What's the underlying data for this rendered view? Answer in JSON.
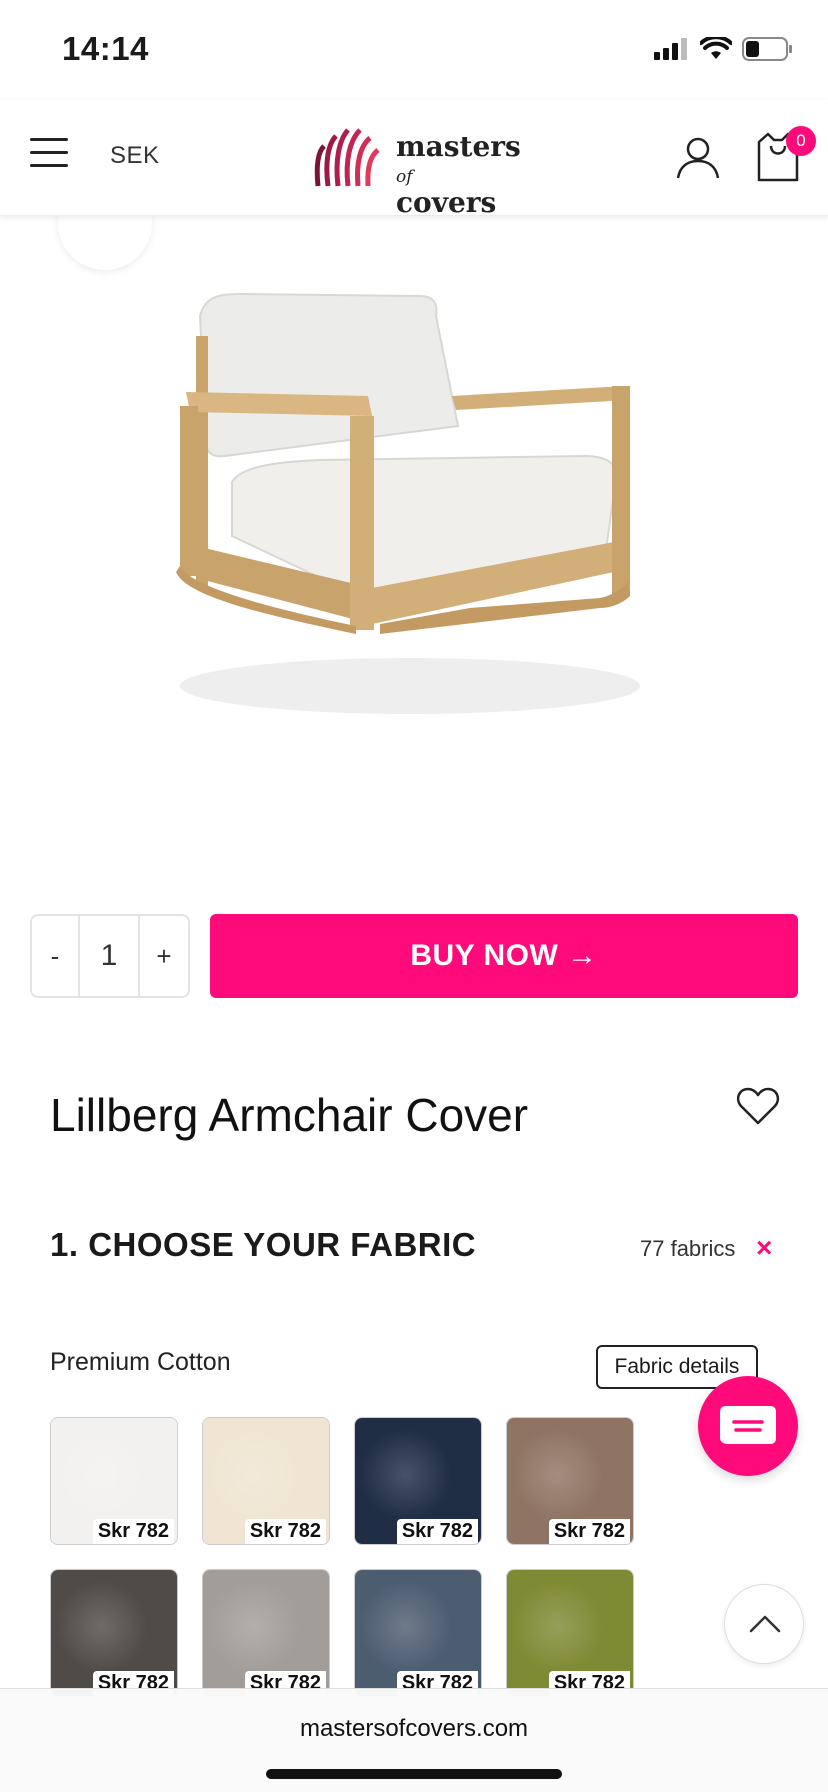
{
  "status_bar": {
    "time": "14:14"
  },
  "header": {
    "currency": "SEK",
    "logo_line1": "masters",
    "logo_of": "of",
    "logo_line2": "covers",
    "cart_count": "0",
    "brand_color": "#ff0a7a"
  },
  "purchase": {
    "qty_minus": "-",
    "qty_value": "1",
    "qty_plus": "+",
    "buy_label": "BUY NOW →"
  },
  "product": {
    "title": "Lillberg Armchair Cover"
  },
  "fabric_section": {
    "heading": "1. CHOOSE YOUR FABRIC",
    "count": "77 fabrics",
    "clear": "×",
    "category": "Premium Cotton",
    "details_button": "Fabric details",
    "swatches": [
      {
        "price": "Skr 782",
        "color": "#f2f1ef"
      },
      {
        "price": "Skr 782",
        "color": "#efe5d2"
      },
      {
        "price": "Skr 782",
        "color": "#1f2d45"
      },
      {
        "price": "Skr 782",
        "color": "#8f7463"
      },
      {
        "price": "Skr 782",
        "color": "#4f4b49"
      },
      {
        "price": "Skr 782",
        "color": "#a39d99"
      },
      {
        "price": "Skr 782",
        "color": "#4d5d70"
      },
      {
        "price": "Skr 782",
        "color": "#7f8a34"
      }
    ]
  },
  "browser": {
    "url": "mastersofcovers.com"
  }
}
